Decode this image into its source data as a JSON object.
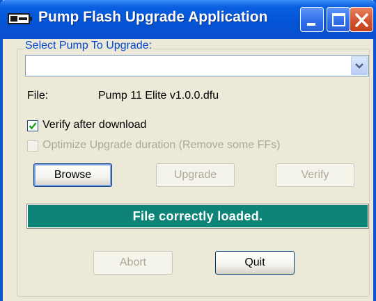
{
  "window": {
    "title": "Pump Flash Upgrade Application",
    "title_bar_color": "#0454d6",
    "icons": [
      "app-icon",
      "minimize-icon",
      "maximize-icon",
      "close-icon"
    ]
  },
  "group": {
    "title": "Select Pump To Upgrade:"
  },
  "pump_select": {
    "value": "",
    "icon": "chevron-down-icon"
  },
  "file": {
    "label": "File:",
    "name": "Pump 11 Elite v1.0.0.dfu"
  },
  "options": [
    {
      "label": "Verify after download",
      "checked": true,
      "enabled": true
    },
    {
      "label": "Optimize Upgrade duration (Remove some FFs)",
      "checked": false,
      "enabled": false
    }
  ],
  "buttons": {
    "browse": "Browse",
    "upgrade": "Upgrade",
    "verify": "Verify",
    "abort": "Abort",
    "quit": "Quit"
  },
  "status": {
    "text": "File correctly loaded.",
    "color": "#0e8478"
  }
}
